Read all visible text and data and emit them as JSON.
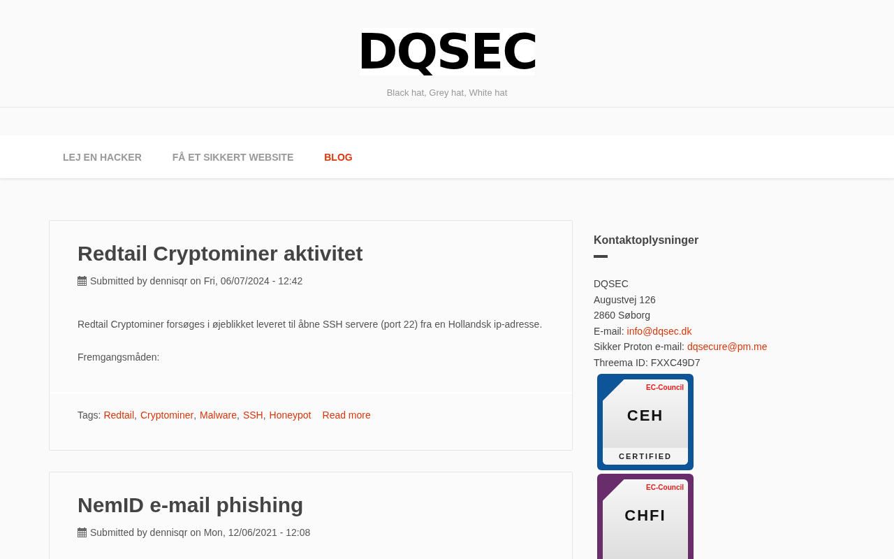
{
  "site": {
    "logo": "DQSEC",
    "slogan": "Black hat, Grey hat, White hat"
  },
  "nav": [
    {
      "label": "LEJ EN HACKER",
      "selected": false
    },
    {
      "label": "FÅ ET SIKKERT WEBSITE",
      "selected": false
    },
    {
      "label": "BLOG",
      "selected": true
    }
  ],
  "articles": [
    {
      "title": "Redtail Cryptominer aktivitet",
      "meta": "Submitted by dennisqr on Fri, 06/07/2024 - 12:42",
      "body": [
        "Redtail Cryptominer forsøges i øjeblikket leveret til åbne SSH servere (port 22) fra en Hollandsk ip-adresse.",
        "Fremgangsmåden:"
      ],
      "tags_label": "Tags:",
      "tags": [
        {
          "label": "Redtail",
          "separator": ","
        },
        {
          "label": "Cryptominer",
          "separator": ","
        },
        {
          "label": "Malware",
          "separator": ","
        },
        {
          "label": "SSH",
          "separator": ","
        },
        {
          "label": "Honeypot"
        }
      ],
      "read_more": "Read more"
    },
    {
      "title": "NemID e-mail phishing",
      "meta": "Submitted by dennisqr on Mon, 12/06/2021 - 12:08"
    }
  ],
  "sidebar": {
    "title": "Kontaktoplysninger",
    "lines": [
      {
        "text": "DQSEC"
      },
      {
        "text": "Augustvej 126"
      },
      {
        "text": "2860 Søborg"
      },
      {
        "text": "E-mail:",
        "link": "info@dqsec.dk"
      },
      {
        "text": "Sikker Proton e-mail:",
        "link": "dqsecure@pm.me"
      },
      {
        "text": "Threema ID: FXXC49D7"
      }
    ],
    "badges": [
      {
        "issuer": "EC-Council",
        "acronym": "CEH",
        "label": "CERTIFIED",
        "color": "#0d5598"
      },
      {
        "issuer": "EC-Council",
        "acronym": "CHFI",
        "color": "#6a2d6b"
      }
    ]
  }
}
